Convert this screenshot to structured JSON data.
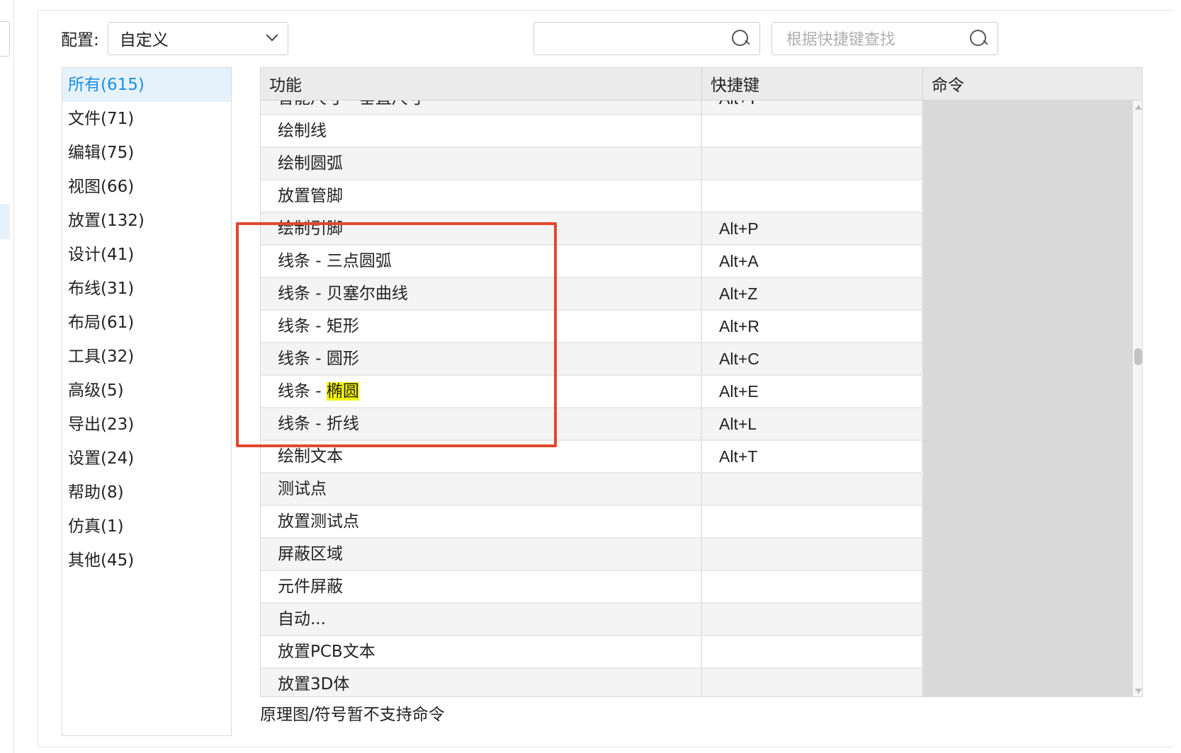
{
  "toolbar": {
    "config_label": "配置:",
    "config_value": "自定义",
    "search_value": "",
    "search_placeholder": "",
    "shortcut_search_placeholder": "根据快捷键查找"
  },
  "categories": [
    {
      "label": "所有(615)",
      "active": true
    },
    {
      "label": "文件(71)"
    },
    {
      "label": "编辑(75)"
    },
    {
      "label": "视图(66)"
    },
    {
      "label": "放置(132)"
    },
    {
      "label": "设计(41)"
    },
    {
      "label": "布线(31)"
    },
    {
      "label": "布局(61)"
    },
    {
      "label": "工具(32)"
    },
    {
      "label": "高级(5)"
    },
    {
      "label": "导出(23)"
    },
    {
      "label": "设置(24)"
    },
    {
      "label": "帮助(8)"
    },
    {
      "label": "仿真(1)"
    },
    {
      "label": "其他(45)"
    }
  ],
  "table": {
    "headers": {
      "function": "功能",
      "shortcut": "快捷键",
      "command": "命令"
    },
    "rows": [
      {
        "function": "智能尺寸 - 垂直尺寸",
        "shortcut": "Alt+T"
      },
      {
        "function": "绘制线",
        "shortcut": ""
      },
      {
        "function": "绘制圆弧",
        "shortcut": ""
      },
      {
        "function": "放置管脚",
        "shortcut": ""
      },
      {
        "function": "绘制引脚",
        "shortcut": "Alt+P"
      },
      {
        "function": "线条 - 三点圆弧",
        "shortcut": "Alt+A"
      },
      {
        "function": "线条 - 贝塞尔曲线",
        "shortcut": "Alt+Z"
      },
      {
        "function": "线条 - 矩形",
        "shortcut": "Alt+R"
      },
      {
        "function": "线条 - 圆形",
        "shortcut": "Alt+C"
      },
      {
        "function_prefix": "线条 - ",
        "function_highlight": "椭圆",
        "shortcut": "Alt+E"
      },
      {
        "function": "线条 - 折线",
        "shortcut": "Alt+L"
      },
      {
        "function": "绘制文本",
        "shortcut": "Alt+T"
      },
      {
        "function": "测试点",
        "shortcut": ""
      },
      {
        "function": "放置测试点",
        "shortcut": ""
      },
      {
        "function": "屏蔽区域",
        "shortcut": ""
      },
      {
        "function": "元件屏蔽",
        "shortcut": ""
      },
      {
        "function": "自动...",
        "shortcut": ""
      },
      {
        "function": "放置PCB文本",
        "shortcut": ""
      },
      {
        "function": "放置3D体",
        "shortcut": ""
      }
    ]
  },
  "footer_note": "原理图/符号暂不支持命令",
  "colors": {
    "accent": "#1a8fe3",
    "annotation_box": "#e0492e",
    "highlight": "#f5f500"
  }
}
